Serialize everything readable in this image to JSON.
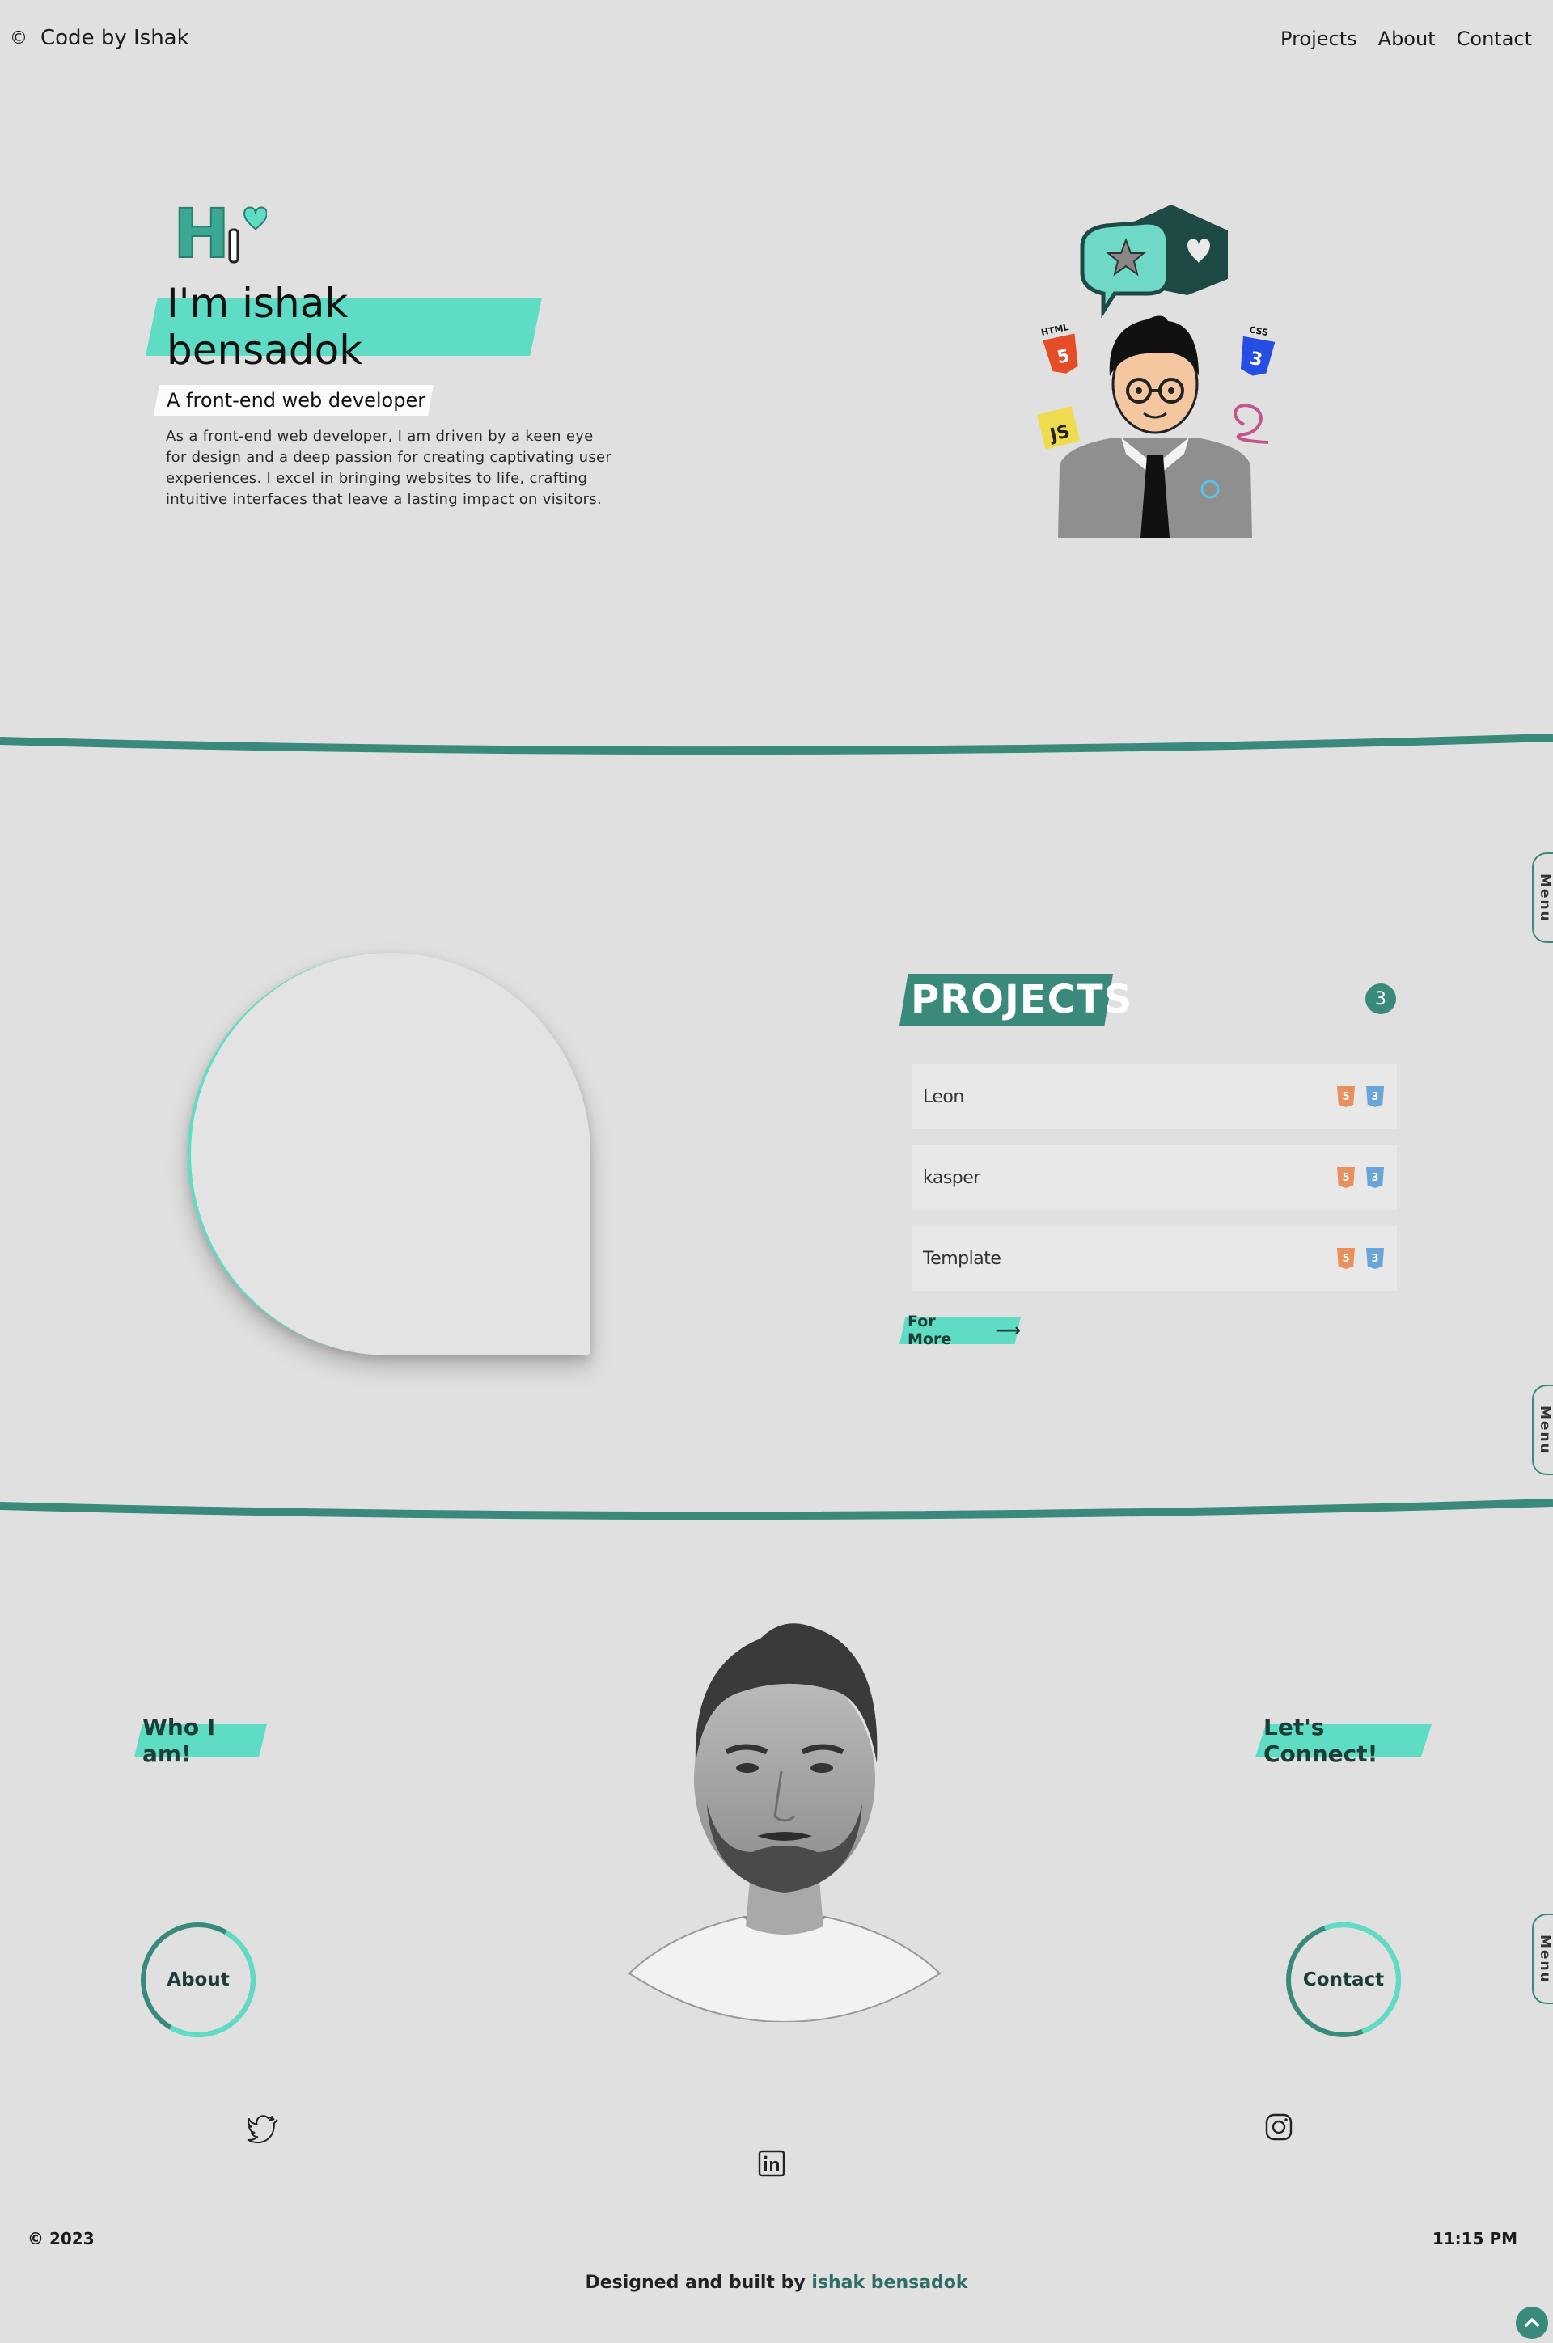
{
  "header": {
    "copyright_symbol": "©",
    "brand": "Code by Ishak",
    "nav": [
      {
        "label": "Projects"
      },
      {
        "label": "About"
      },
      {
        "label": "Contact"
      }
    ]
  },
  "hero": {
    "greeting_icon": "hi-heart-icon",
    "name": "I'm ishak bensadok",
    "role": "A front-end web developer",
    "description": "As a front-end web developer, I am driven by a keen eye for design and a deep passion for creating captivating user experiences. I excel in bringing websites to life, crafting intuitive interfaces that leave a lasting impact on visitors.",
    "illustration": "developer-avatar-illustration",
    "illustration_badges": [
      "HTML",
      "CSS",
      "JS"
    ]
  },
  "side_menu": {
    "label": "Menu"
  },
  "projects": {
    "title": "PROJECTS",
    "count": "3",
    "items": [
      {
        "name": "Leon",
        "tech": [
          "html5-icon",
          "css3-icon"
        ]
      },
      {
        "name": "kasper",
        "tech": [
          "html5-icon",
          "css3-icon"
        ]
      },
      {
        "name": "Template",
        "tech": [
          "html5-icon",
          "css3-icon"
        ]
      }
    ],
    "more_label": "For More"
  },
  "about": {
    "who_label": "Who I am!",
    "connect_label": "Let's Connect!",
    "about_button": "About",
    "contact_button": "Contact",
    "social": [
      "twitter-icon",
      "linkedin-icon",
      "instagram-icon"
    ]
  },
  "footer": {
    "year": "© 2023",
    "time": "11:15 PM",
    "credit_prefix": "Designed and built by",
    "credit_author": "ishak bensadok"
  },
  "colors": {
    "background": "#e0e0e0",
    "accent": "#5fdcc4",
    "accent_dark": "#3a8a7c",
    "text": "#1c1c1c"
  }
}
